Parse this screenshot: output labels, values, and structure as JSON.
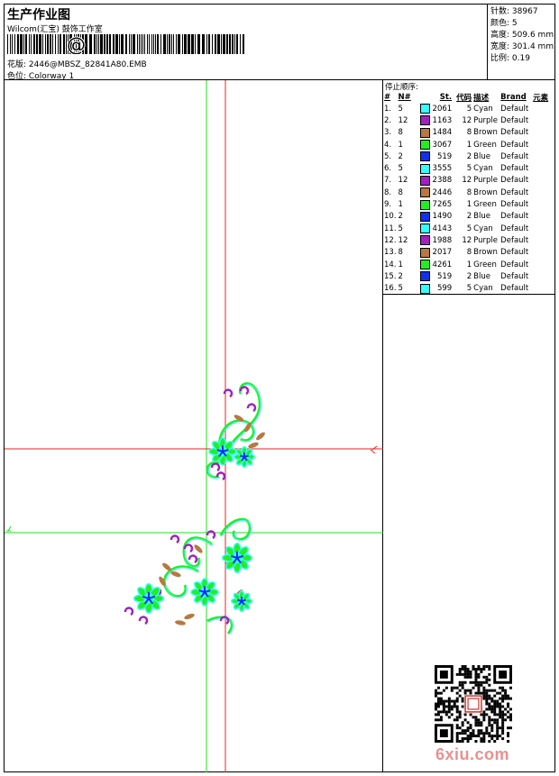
{
  "header": {
    "title": "生产作业图",
    "company": "Wilcom(汇宝) 鼓饰工作室",
    "design_label": "花版:",
    "design_file": "2446@MBSZ_82841A80.EMB",
    "colorway_label": "色位:",
    "colorway": "Colorway 1"
  },
  "stats": [
    {
      "label": "针数:",
      "value": "38967"
    },
    {
      "label": "颜色:",
      "value": "5"
    },
    {
      "label": "高度:",
      "value": "509.6 mm"
    },
    {
      "label": "宽度:",
      "value": "301.4 mm"
    },
    {
      "label": "比例:",
      "value": "0.19"
    }
  ],
  "sequence": {
    "title": "停止顺序:",
    "headers": [
      "#",
      "N#",
      "",
      "St.",
      "代码",
      "描述",
      "Brand",
      "元素"
    ],
    "rows": [
      {
        "no": "1.",
        "n": "5",
        "color": "#33ffff",
        "st": "2061",
        "code": "5",
        "desc": "Cyan",
        "brand": "Default"
      },
      {
        "no": "2.",
        "n": "12",
        "color": "#a020c0",
        "st": "1163",
        "code": "12",
        "desc": "Purple",
        "brand": "Default"
      },
      {
        "no": "3.",
        "n": "8",
        "color": "#b87840",
        "st": "1484",
        "code": "8",
        "desc": "Brown",
        "brand": "Default"
      },
      {
        "no": "4.",
        "n": "1",
        "color": "#22ee22",
        "st": "3067",
        "code": "1",
        "desc": "Green",
        "brand": "Default"
      },
      {
        "no": "5.",
        "n": "2",
        "color": "#1030ee",
        "st": "519",
        "code": "2",
        "desc": "Blue",
        "brand": "Default"
      },
      {
        "no": "6.",
        "n": "5",
        "color": "#33ffff",
        "st": "3555",
        "code": "5",
        "desc": "Cyan",
        "brand": "Default"
      },
      {
        "no": "7.",
        "n": "12",
        "color": "#a020c0",
        "st": "2388",
        "code": "12",
        "desc": "Purple",
        "brand": "Default"
      },
      {
        "no": "8.",
        "n": "8",
        "color": "#b87840",
        "st": "2446",
        "code": "8",
        "desc": "Brown",
        "brand": "Default"
      },
      {
        "no": "9.",
        "n": "1",
        "color": "#22ee22",
        "st": "7265",
        "code": "1",
        "desc": "Green",
        "brand": "Default"
      },
      {
        "no": "10.",
        "n": "2",
        "color": "#1030ee",
        "st": "1490",
        "code": "2",
        "desc": "Blue",
        "brand": "Default"
      },
      {
        "no": "11.",
        "n": "5",
        "color": "#33ffff",
        "st": "4143",
        "code": "5",
        "desc": "Cyan",
        "brand": "Default"
      },
      {
        "no": "12.",
        "n": "12",
        "color": "#a020c0",
        "st": "1988",
        "code": "12",
        "desc": "Purple",
        "brand": "Default"
      },
      {
        "no": "13.",
        "n": "8",
        "color": "#b87840",
        "st": "2017",
        "code": "8",
        "desc": "Brown",
        "brand": "Default"
      },
      {
        "no": "14.",
        "n": "1",
        "color": "#22ee22",
        "st": "4261",
        "code": "1",
        "desc": "Green",
        "brand": "Default"
      },
      {
        "no": "15.",
        "n": "2",
        "color": "#1030ee",
        "st": "519",
        "code": "2",
        "desc": "Blue",
        "brand": "Default"
      },
      {
        "no": "16.",
        "n": "5",
        "color": "#33ffff",
        "st": "599",
        "code": "5",
        "desc": "Cyan",
        "brand": "Default"
      }
    ]
  },
  "watermark": {
    "logo_text": "6xiu.com"
  },
  "colors": {
    "guide_green": "#22dd22",
    "guide_red": "#ee2222",
    "logo_pink": "#e9908e"
  }
}
